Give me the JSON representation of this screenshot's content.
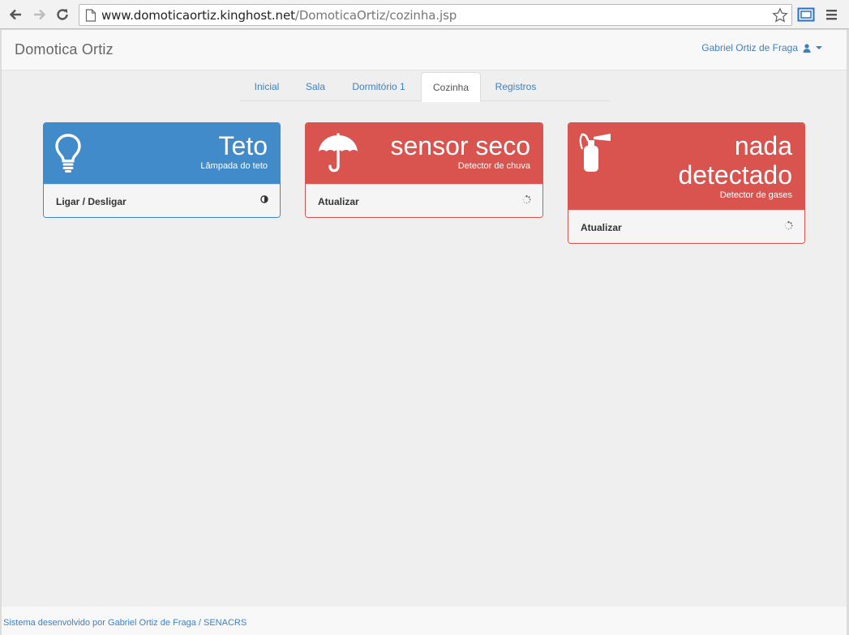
{
  "browser": {
    "url_host": "www.domoticaortiz.kinghost.net",
    "url_path": "/DomoticaOrtiz/cozinha.jsp"
  },
  "navbar": {
    "brand": "Domotica Ortiz",
    "user_name": "Gabriel Ortiz de Fraga"
  },
  "tabs": [
    {
      "label": "Inicial",
      "active": false
    },
    {
      "label": "Sala",
      "active": false
    },
    {
      "label": "Dormitório 1",
      "active": false
    },
    {
      "label": "Cozinha",
      "active": true
    },
    {
      "label": "Registros",
      "active": false
    }
  ],
  "panels": [
    {
      "color": "#428bca",
      "icon": "lightbulb-icon",
      "value": "Teto",
      "subtitle": "Lâmpada do teto",
      "action": "Ligar / Desligar",
      "action_icon": "adjust-icon"
    },
    {
      "color": "#d9534f",
      "icon": "umbrella-icon",
      "value": "sensor seco",
      "subtitle": "Detector de chuva",
      "action": "Atualizar",
      "action_icon": "spinner-icon"
    },
    {
      "color": "#d9534f",
      "icon": "fire-extinguisher-icon",
      "value_line1": "nada",
      "value_line2": "detectado",
      "subtitle": "Detector de gases",
      "action": "Atualizar",
      "action_icon": "spinner-icon"
    }
  ],
  "footer": {
    "text": "Sistema desenvolvido por Gabriel Ortiz de Fraga / SENACRS"
  }
}
